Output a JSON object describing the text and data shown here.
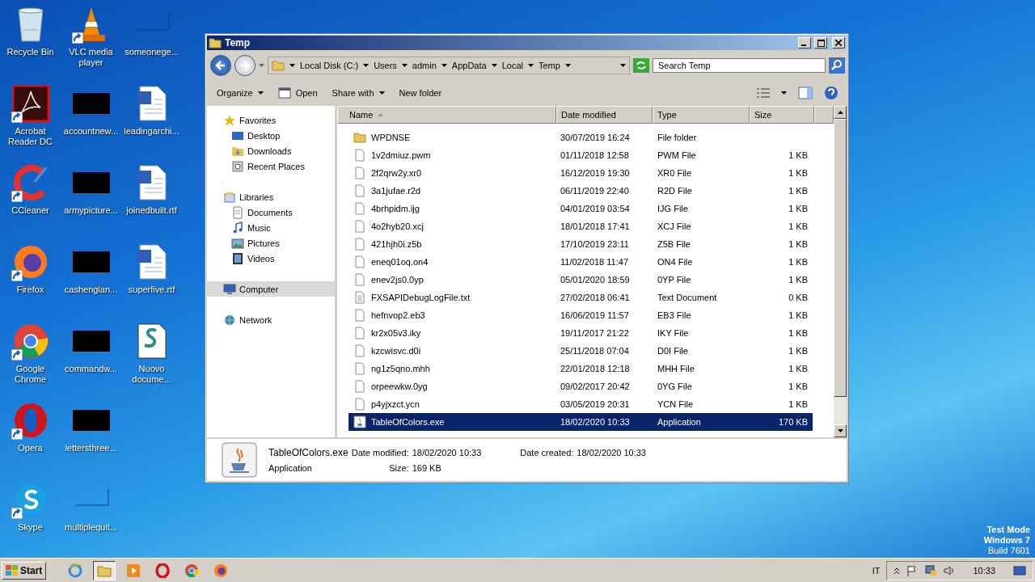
{
  "desktop_columns": [
    [
      {
        "label": "Recycle Bin",
        "kind": "recycle",
        "shortcut": false
      },
      {
        "label": "Acrobat Reader DC",
        "kind": "pdf",
        "shortcut": true
      },
      {
        "label": "CCleaner",
        "kind": "ccleaner",
        "shortcut": true
      },
      {
        "label": "Firefox",
        "kind": "firefox",
        "shortcut": true
      },
      {
        "label": "Google Chrome",
        "kind": "chrome",
        "shortcut": true
      },
      {
        "label": "Opera",
        "kind": "opera",
        "shortcut": true
      },
      {
        "label": "Skype",
        "kind": "skype",
        "shortcut": true
      }
    ],
    [
      {
        "label": "VLC media player",
        "kind": "vlc",
        "shortcut": true
      },
      {
        "label": "accountnew...",
        "kind": "black",
        "shortcut": false
      },
      {
        "label": "armypicture...",
        "kind": "black",
        "shortcut": false
      },
      {
        "label": "cashenglan...",
        "kind": "black",
        "shortcut": false
      },
      {
        "label": "commandw...",
        "kind": "black",
        "shortcut": false
      },
      {
        "label": "lettersthree...",
        "kind": "black",
        "shortcut": false
      },
      {
        "label": "multiplequit...",
        "kind": "blank",
        "shortcut": false
      }
    ],
    [
      {
        "label": "someonege...",
        "kind": "blank",
        "shortcut": false
      },
      {
        "label": "leadingarchi...",
        "kind": "word",
        "shortcut": false
      },
      {
        "label": "joinedbuilt.rtf",
        "kind": "word",
        "shortcut": false
      },
      {
        "label": "superfive.rtf",
        "kind": "word",
        "shortcut": false
      },
      {
        "label": "Nuovo docume...",
        "kind": "script",
        "shortcut": false
      }
    ]
  ],
  "window": {
    "title": "Temp",
    "breadcrumb": [
      "Local Disk (C:)",
      "Users",
      "admin",
      "AppData",
      "Local",
      "Temp"
    ],
    "search": {
      "placeholder": "Search Temp"
    },
    "toolbar": [
      {
        "label": "Organize",
        "kind": "menu"
      },
      {
        "label": "Open",
        "kind": "open"
      },
      {
        "label": "Share with",
        "kind": "menu"
      },
      {
        "label": "New folder",
        "kind": "plain"
      }
    ],
    "nav": [
      {
        "label": "Favorites",
        "kind": "star",
        "selected": false,
        "children": [
          {
            "label": "Desktop",
            "kind": "desktop",
            "selected": false
          },
          {
            "label": "Downloads",
            "kind": "downloads",
            "selected": false
          },
          {
            "label": "Recent Places",
            "kind": "recent",
            "selected": false
          }
        ]
      },
      {
        "label": "Libraries",
        "kind": "library",
        "selected": false,
        "children": [
          {
            "label": "Documents",
            "kind": "documents",
            "selected": false
          },
          {
            "label": "Music",
            "kind": "music",
            "selected": false
          },
          {
            "label": "Pictures",
            "kind": "pictures",
            "selected": false
          },
          {
            "label": "Videos",
            "kind": "videos",
            "selected": false
          }
        ]
      },
      {
        "label": "Computer",
        "kind": "computer",
        "selected": true
      },
      {
        "label": "Network",
        "kind": "network",
        "selected": false
      }
    ],
    "columns": [
      {
        "label": "Name",
        "sorted": true
      },
      {
        "label": "Date modified",
        "sorted": false
      },
      {
        "label": "Type",
        "sorted": false
      },
      {
        "label": "Size",
        "sorted": false
      }
    ],
    "rows": [
      {
        "name": "WPDNSE",
        "date": "30/07/2019 16:24",
        "type": "File folder",
        "kind": "folder",
        "selected": false
      },
      {
        "name": "1v2dmiuz.pwm",
        "date": "01/11/2018 12:58",
        "type": "PWM File",
        "size": "1 KB",
        "kind": "file",
        "selected": false
      },
      {
        "name": "2f2qrw2y.xr0",
        "date": "16/12/2019 19:30",
        "type": "XR0 File",
        "size": "1 KB",
        "kind": "file",
        "selected": false
      },
      {
        "name": "3a1jufae.r2d",
        "date": "06/11/2019 22:40",
        "type": "R2D File",
        "size": "1 KB",
        "kind": "file",
        "selected": false
      },
      {
        "name": "4brhpidm.ijg",
        "date": "04/01/2019 03:54",
        "type": "IJG File",
        "size": "1 KB",
        "kind": "file",
        "selected": false
      },
      {
        "name": "4o2hyb20.xcj",
        "date": "18/01/2018 17:41",
        "type": "XCJ File",
        "size": "1 KB",
        "kind": "file",
        "selected": false
      },
      {
        "name": "421hjh0i.z5b",
        "date": "17/10/2019 23:11",
        "type": "Z5B File",
        "size": "1 KB",
        "kind": "file",
        "selected": false
      },
      {
        "name": "eneq01oq.on4",
        "date": "11/02/2018 11:47",
        "type": "ON4 File",
        "size": "1 KB",
        "kind": "file",
        "selected": false
      },
      {
        "name": "enev2js0.0yp",
        "date": "05/01/2020 18:59",
        "type": "0YP File",
        "size": "1 KB",
        "kind": "file",
        "selected": false
      },
      {
        "name": "FXSAPIDebugLogFile.txt",
        "date": "27/02/2018 06:41",
        "type": "Text Document",
        "size": "0 KB",
        "kind": "text",
        "selected": false
      },
      {
        "name": "hefnvop2.eb3",
        "date": "16/06/2019 11:57",
        "type": "EB3 File",
        "size": "1 KB",
        "kind": "file",
        "selected": false
      },
      {
        "name": "kr2x05v3.iky",
        "date": "19/11/2017 21:22",
        "type": "IKY File",
        "size": "1 KB",
        "kind": "file",
        "selected": false
      },
      {
        "name": "kzcwisvc.d0i",
        "date": "25/11/2018 07:04",
        "type": "D0I File",
        "size": "1 KB",
        "kind": "file",
        "selected": false
      },
      {
        "name": "ng1z5qno.mhh",
        "date": "22/01/2018 12:18",
        "type": "MHH File",
        "size": "1 KB",
        "kind": "file",
        "selected": false
      },
      {
        "name": "orpeewkw.0yg",
        "date": "09/02/2017 20:42",
        "type": "0YG File",
        "size": "1 KB",
        "kind": "file",
        "selected": false
      },
      {
        "name": "p4yjxzct.ycn",
        "date": "03/05/2019 20:31",
        "type": "YCN File",
        "size": "1 KB",
        "kind": "file",
        "selected": false
      },
      {
        "name": "TableOfColors.exe",
        "date": "18/02/2020 10:33",
        "type": "Application",
        "size": "170 KB",
        "kind": "java",
        "selected": true
      }
    ],
    "details": {
      "name": "TableOfColors.exe",
      "type": "Application",
      "modified_label": "Date modified:",
      "modified": "18/02/2020 10:33",
      "size_label": "Size:",
      "size": "169 KB",
      "created_label": "Date created:",
      "created": "18/02/2020 10:33"
    }
  },
  "os_notice": [
    "Test Mode",
    "Windows 7",
    "Build 7601"
  ],
  "taskbar": {
    "start": "Start",
    "apps": [
      {
        "kind": "ie",
        "selected": false
      },
      {
        "kind": "explorer",
        "selected": true
      },
      {
        "kind": "media",
        "selected": false
      },
      {
        "kind": "opera",
        "selected": false
      },
      {
        "kind": "chrome",
        "selected": false
      },
      {
        "kind": "firefox",
        "selected": false
      }
    ],
    "language": "IT",
    "clock": "10:33"
  }
}
